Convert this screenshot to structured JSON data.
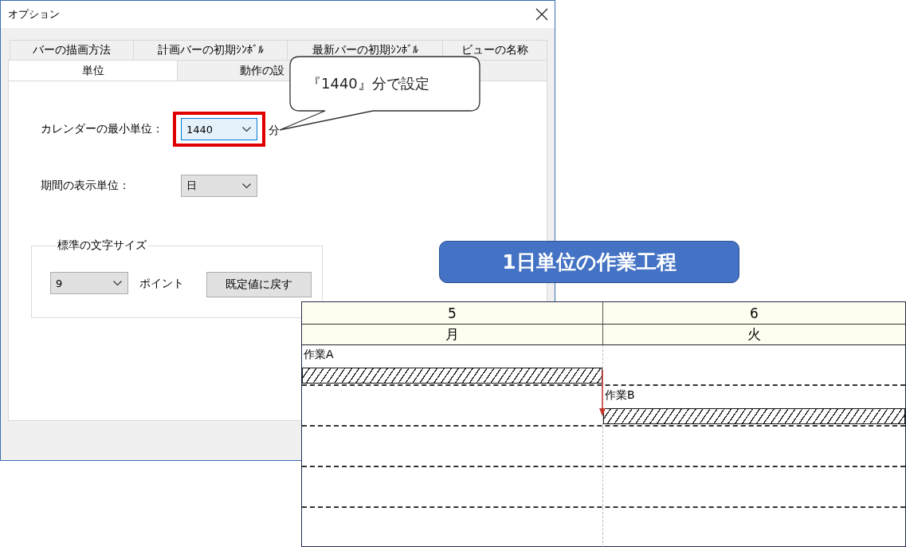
{
  "window": {
    "title": "オプション"
  },
  "tab_rows": [
    {
      "tabs": [
        {
          "label": "バーの描画方法",
          "selected": false
        },
        {
          "label": "計画バーの初期ｼﾝﾎﾞﾙ",
          "selected": false
        },
        {
          "label": "最新バーの初期ｼﾝﾎﾞﾙ",
          "selected": false
        },
        {
          "label": "ビューの名称",
          "selected": false
        }
      ]
    },
    {
      "tabs": [
        {
          "label": "単位",
          "selected": true
        },
        {
          "label": "動作の設",
          "selected": false
        },
        {
          "selected": false
        }
      ]
    }
  ],
  "settings": [
    {
      "label": "カレンダーの最小単位：",
      "value": "1440",
      "focused": true,
      "highlighted": true,
      "suffix": "分"
    },
    {
      "label": "期間の表示単位：",
      "value": "日",
      "focused": false,
      "highlighted": false
    }
  ],
  "font_size_group": {
    "title": "標準の文字サイズ",
    "value": "9",
    "focused": false,
    "unit": "ポイント",
    "reset_button": "既定値に戻す"
  },
  "callout": {
    "text": "『1440』分で設定"
  },
  "title_badge": {
    "text": "1日単位の作業工程"
  },
  "gantt": {
    "columns": [
      {
        "date": "5",
        "weekday": "月"
      },
      {
        "date": "6",
        "weekday": "火"
      }
    ],
    "rows": [
      {
        "cells": [
          {
            "label": "作業A",
            "bar": true,
            "predecessor": false
          },
          {
            "bar": false,
            "predecessor": false
          }
        ]
      },
      {
        "cells": [
          {
            "bar": false,
            "predecessor": false
          },
          {
            "label": "作業B",
            "bar": true,
            "predecessor": true
          }
        ]
      },
      {
        "cells": [
          {
            "bar": false,
            "predecessor": false
          },
          {
            "bar": false,
            "predecessor": false
          }
        ]
      },
      {
        "cells": [
          {
            "bar": false,
            "predecessor": false
          },
          {
            "bar": false,
            "predecessor": false
          }
        ]
      },
      {
        "cells": [
          {
            "bar": false,
            "predecessor": false
          },
          {
            "bar": false,
            "predecessor": false
          }
        ]
      }
    ]
  }
}
